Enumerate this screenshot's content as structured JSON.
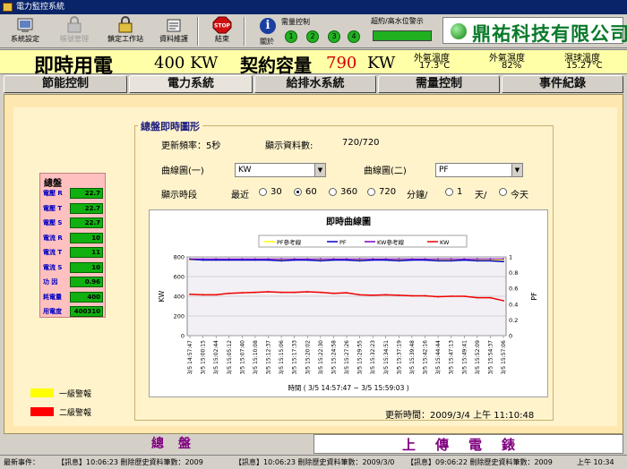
{
  "window": {
    "title": "電力監控系統"
  },
  "toolbar": {
    "system_settings": "系統設定",
    "disabled_btn": "帳號管理",
    "lock_station": "鎖定工作站",
    "data_maint": "資料維護",
    "exit": "結束",
    "about": "關於",
    "demand_control_label": "需量控制",
    "levels": [
      "1",
      "2",
      "3",
      "4"
    ],
    "contract_warn_label": "超約/高水位警示"
  },
  "logo": {
    "text": "鼎祐科技有限公司"
  },
  "infobar": {
    "realtime_label": "即時用電",
    "realtime_value": "400 KW",
    "contract_label": "契約容量",
    "contract_value": "790",
    "contract_unit": "KW",
    "outdoor_temp_label": "外氣溫度",
    "outdoor_temp_value": "17.3°C",
    "outdoor_humidity_label": "外氣濕度",
    "outdoor_humidity_value": "82%",
    "wetbulb_label": "濕球溫度",
    "wetbulb_value": "15.27°C"
  },
  "tabs": [
    "節能控制",
    "電力系統",
    "給排水系統",
    "需量控制",
    "事件紀錄"
  ],
  "summary": {
    "title": "總盤",
    "rows": [
      {
        "label": "電壓 R",
        "value": "22.7"
      },
      {
        "label": "電壓 T",
        "value": "22.7"
      },
      {
        "label": "電壓 S",
        "value": "22.7"
      },
      {
        "label": "電流 R",
        "value": "10"
      },
      {
        "label": "電流 T",
        "value": "11"
      },
      {
        "label": "電流 S",
        "value": "10"
      },
      {
        "label": "功 因",
        "value": "0.96"
      },
      {
        "label": "耗電量",
        "value": "400"
      },
      {
        "label": "用電度",
        "value": "400310"
      }
    ]
  },
  "legend": {
    "level1": "一級警報",
    "level2": "二級警報"
  },
  "realtime_panel": {
    "title": "總盤即時圖形",
    "refresh": "更新頻率：5秒",
    "display_count_label": "顯示資料數:",
    "display_count_value": "720/720",
    "curve1_label": "曲線圖(一)",
    "curve1_value": "KW",
    "curve2_label": "曲線圖(二)",
    "curve2_value": "PF",
    "period_label": "顯示時段",
    "recent_label": "最近",
    "options": [
      "30",
      "60",
      "360",
      "720"
    ],
    "minutes_label": "分鐘/",
    "day_option": "1",
    "day_label": "天/",
    "today_label": "今天",
    "update_time": "更新時間：2009/3/4 上午 11:10:48"
  },
  "chart_data": {
    "type": "line",
    "title": "即時曲線圖",
    "xlabel": "時間 ( 3/5 14:57:47 ~ 3/5 15:59:03 )",
    "ylabel": "KW",
    "y2label": "PF",
    "ylim": [
      0,
      800
    ],
    "y2lim": [
      0,
      1
    ],
    "yticks": [
      "800",
      "600",
      "400",
      "200",
      "0"
    ],
    "y2ticks": [
      "1",
      "0.8",
      "0.6",
      "0.4",
      "0.2",
      "0"
    ],
    "categories": [
      "3/5 14:57:47",
      "3/5 15:00:15",
      "3/5 15:02:44",
      "3/5 15:05:12",
      "3/5 15:07:40",
      "3/5 15:10:08",
      "3/5 15:12:37",
      "3/5 15:15:06",
      "3/5 15:17:33",
      "3/5 15:20:02",
      "3/5 15:22:30",
      "3/5 15:24:58",
      "3/5 15:27:26",
      "3/5 15:29:55",
      "3/5 15:32:23",
      "3/5 15:34:51",
      "3/5 15:37:19",
      "3/5 15:39:48",
      "3/5 15:42:16",
      "3/5 15:44:44",
      "3/5 15:47:13",
      "3/5 15:49:41",
      "3/5 15:52:09",
      "3/5 15:54:37",
      "3/5 15:57:06"
    ],
    "series": [
      {
        "name": "PF參考線",
        "color": "#ffff00",
        "axis": "y2",
        "values": [
          0.96,
          0.96,
          0.96,
          0.96,
          0.96,
          0.96,
          0.96,
          0.96,
          0.96,
          0.96,
          0.96,
          0.96,
          0.96,
          0.96,
          0.96,
          0.96,
          0.96,
          0.96,
          0.96,
          0.96,
          0.96,
          0.96,
          0.96,
          0.96,
          0.96
        ]
      },
      {
        "name": "PF",
        "color": "#0000cc",
        "axis": "y2",
        "values": [
          0.97,
          0.96,
          0.96,
          0.96,
          0.96,
          0.96,
          0.96,
          0.95,
          0.96,
          0.96,
          0.95,
          0.96,
          0.96,
          0.95,
          0.96,
          0.96,
          0.95,
          0.96,
          0.96,
          0.95,
          0.95,
          0.96,
          0.95,
          0.95,
          0.94
        ]
      },
      {
        "name": "KW參考線",
        "color": "#8000c0",
        "axis": "y",
        "values": [
          780,
          780,
          780,
          780,
          780,
          780,
          780,
          780,
          780,
          780,
          780,
          780,
          780,
          780,
          780,
          780,
          780,
          780,
          780,
          780,
          780,
          780,
          780,
          780,
          780
        ]
      },
      {
        "name": "KW",
        "color": "#ee0000",
        "axis": "y",
        "values": [
          420,
          415,
          415,
          430,
          435,
          440,
          445,
          440,
          440,
          445,
          440,
          430,
          435,
          415,
          410,
          415,
          410,
          405,
          405,
          395,
          400,
          400,
          385,
          385,
          355
        ]
      }
    ]
  },
  "status": {
    "label": "最新事件：",
    "events": [
      "【訊息】10:06:23 刪除歷史資料筆數：2009",
      "【訊息】10:06:23 刪除歷史資料筆數：2009/3/0",
      "【訊息】09:06:22 刪除歷史資料筆數：2009",
      "上午 10:34"
    ]
  },
  "bottom": {
    "summary_btn": "總盤",
    "upload_btn": "上傳電錶"
  }
}
